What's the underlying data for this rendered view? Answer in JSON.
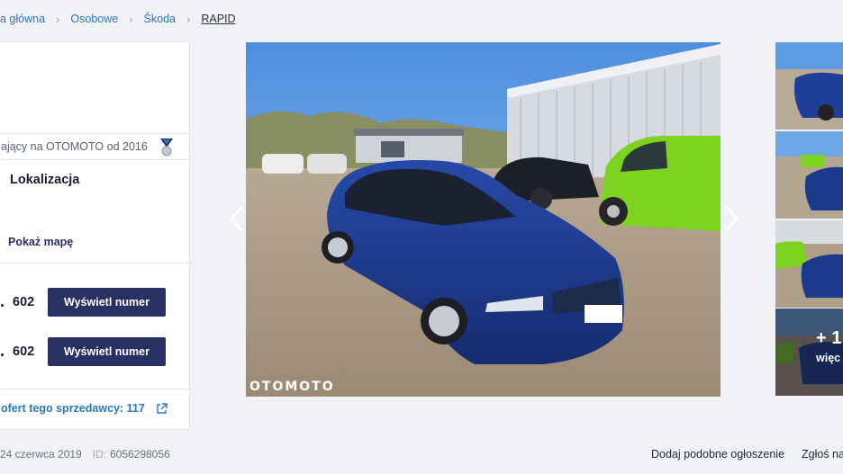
{
  "breadcrumb": {
    "home": "a główna",
    "category": "Osobowe",
    "make": "Škoda",
    "model": "RAPID"
  },
  "seller": {
    "member_since": "ający na OTOMOTO od 2016",
    "location_title": "Lokalizacja",
    "show_map": "Pokaż mapę",
    "phones": [
      {
        "number": "602",
        "button": "Wyświetl numer"
      },
      {
        "number": "602",
        "button": "Wyświetl numer"
      }
    ],
    "all_offers": "ofert tego sprzedawcy: 117"
  },
  "gallery": {
    "watermark": "OTOMOTO",
    "more_count": "+ 1",
    "more_label": "więc"
  },
  "footer": {
    "date": "24 czerwca 2019",
    "id_label": "ID:",
    "id_value": "6056298056",
    "add_similar": "Dodaj podobne ogłoszenie",
    "report": "Zgłoś na"
  },
  "colors": {
    "link": "#2a78b8",
    "button": "#283064",
    "car": "#1c3a8c",
    "van": "#7ed321"
  }
}
